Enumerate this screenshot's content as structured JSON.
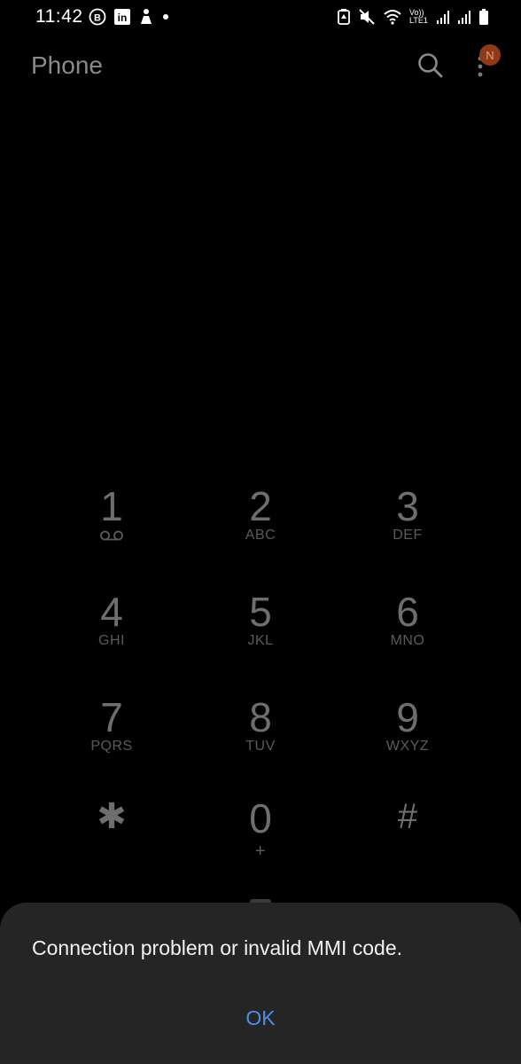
{
  "status_bar": {
    "time": "11:42",
    "signal_label": "Vo)) LTE1"
  },
  "header": {
    "title": "Phone",
    "avatar_letter": "N"
  },
  "dialpad": {
    "keys": [
      {
        "digit": "1",
        "sub": ""
      },
      {
        "digit": "2",
        "sub": "ABC"
      },
      {
        "digit": "3",
        "sub": "DEF"
      },
      {
        "digit": "4",
        "sub": "GHI"
      },
      {
        "digit": "5",
        "sub": "JKL"
      },
      {
        "digit": "6",
        "sub": "MNO"
      },
      {
        "digit": "7",
        "sub": "PQRS"
      },
      {
        "digit": "8",
        "sub": "TUV"
      },
      {
        "digit": "9",
        "sub": "WXYZ"
      },
      {
        "digit": "✱",
        "sub": ""
      },
      {
        "digit": "0",
        "sub": "+"
      },
      {
        "digit": "#",
        "sub": ""
      }
    ]
  },
  "dialog": {
    "message": "Connection problem or invalid MMI code.",
    "ok_label": "OK"
  },
  "colors": {
    "background": "#000000",
    "dialog_bg": "#252525",
    "accent": "#4c8fe8"
  }
}
